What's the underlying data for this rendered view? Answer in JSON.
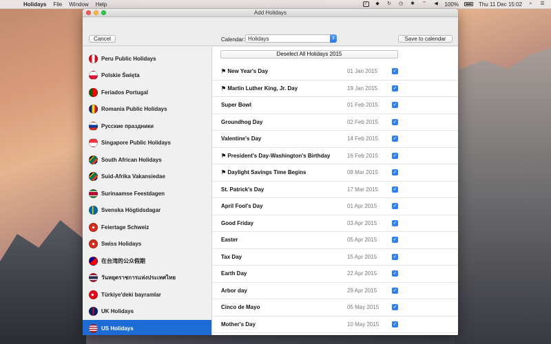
{
  "menubar": {
    "apple": "",
    "app_name": "Holidays",
    "menus": [
      "File",
      "Window",
      "Help"
    ],
    "battery": "100%",
    "clock": "Thu 11 Dec  15:02"
  },
  "window": {
    "title": "Add Holidays",
    "cancel_label": "Cancel",
    "calendar_label": "Calendar:",
    "calendar_value": "Holidays",
    "save_label": "Save to calendar",
    "deselect_label": "Deselect All Holidays 2015"
  },
  "sidebar": {
    "items": [
      {
        "label": "Peru Public Holidays",
        "flag": "peru-flag-icon"
      },
      {
        "label": "Polskie Święta",
        "flag": "poland-flag-icon"
      },
      {
        "label": "Feriados Portugal",
        "flag": "portugal-flag-icon"
      },
      {
        "label": "Romania Public Holidays",
        "flag": "romania-flag-icon"
      },
      {
        "label": "Русские праздники",
        "flag": "russia-flag-icon"
      },
      {
        "label": "Singapore Public Holidays",
        "flag": "singapore-flag-icon"
      },
      {
        "label": "South African Holidays",
        "flag": "south-africa-flag-icon"
      },
      {
        "label": "Suid-Afrika Vakansiedae",
        "flag": "south-africa-flag-icon"
      },
      {
        "label": "Surinaamse Feestdagen",
        "flag": "suriname-flag-icon"
      },
      {
        "label": "Svenska Högtidsdagar",
        "flag": "sweden-flag-icon"
      },
      {
        "label": "Feiertage Schweiz",
        "flag": "switzerland-flag-icon"
      },
      {
        "label": "Swiss Holidays",
        "flag": "switzerland-flag-icon"
      },
      {
        "label": "在台湾的公众假期",
        "flag": "taiwan-flag-icon"
      },
      {
        "label": "วันหยุดราชการแห่งประเทศไทย",
        "flag": "thailand-flag-icon"
      },
      {
        "label": "Türkiye'deki bayramlar",
        "flag": "turkey-flag-icon"
      },
      {
        "label": "UK Holidays",
        "flag": "uk-flag-icon"
      },
      {
        "label": "US Holidays",
        "flag": "us-flag-icon",
        "selected": true
      }
    ]
  },
  "holidays": [
    {
      "name": "⚑ New Year's Day",
      "date": "01 Jan 2015",
      "checked": true
    },
    {
      "name": "⚑ Martin Luther King, Jr. Day",
      "date": "19 Jan 2015",
      "checked": true
    },
    {
      "name": "Super Bowl",
      "date": "01 Feb 2015",
      "checked": true
    },
    {
      "name": "Groundhog Day",
      "date": "02 Feb 2015",
      "checked": true
    },
    {
      "name": "Valentine's Day",
      "date": "14 Feb 2015",
      "checked": true
    },
    {
      "name": "⚑ President's Day-Washington's Birthday",
      "date": "16 Feb 2015",
      "checked": true
    },
    {
      "name": "⚑ Daylight Savings Time Begins",
      "date": "08 Mar 2015",
      "checked": true
    },
    {
      "name": "St. Patrick's Day",
      "date": "17 Mar 2015",
      "checked": true
    },
    {
      "name": "April Fool's Day",
      "date": "01 Apr 2015",
      "checked": true
    },
    {
      "name": "Good Friday",
      "date": "03 Apr 2015",
      "checked": true
    },
    {
      "name": "Easter",
      "date": "05 Apr 2015",
      "checked": true
    },
    {
      "name": "Tax Day",
      "date": "15 Apr 2015",
      "checked": true
    },
    {
      "name": "Earth Day",
      "date": "22 Apr 2015",
      "checked": true
    },
    {
      "name": "Arbor day",
      "date": "29 Apr 2015",
      "checked": true
    },
    {
      "name": "Cinco de Mayo",
      "date": "05 May 2015",
      "checked": true
    },
    {
      "name": "Mother's Day",
      "date": "10 May 2015",
      "checked": true
    }
  ],
  "colors": {
    "accent": "#1d6cd6",
    "checkbox": "#2f7fef"
  }
}
